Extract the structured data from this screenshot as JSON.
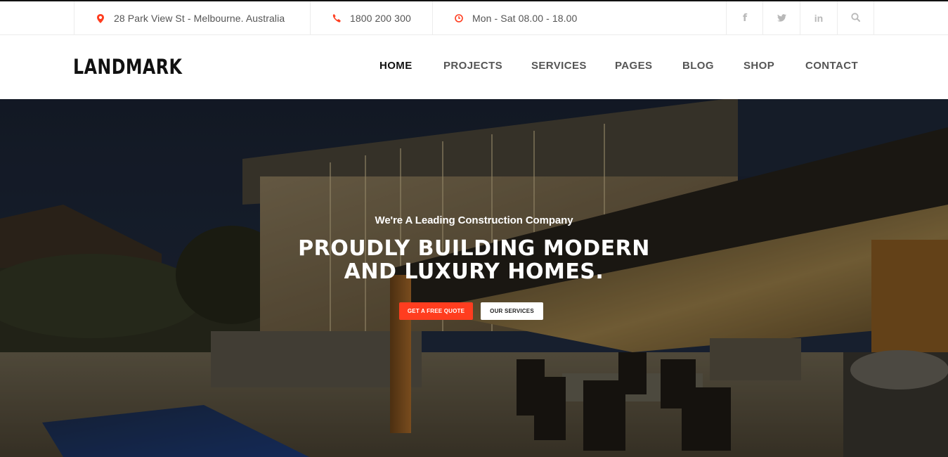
{
  "topbar": {
    "address": "28 Park View St - Melbourne. Australia",
    "phone": "1800 200 300",
    "hours": "Mon - Sat 08.00 - 18.00",
    "icons": {
      "address": "map-marker-icon",
      "phone": "phone-icon",
      "hours": "clock-icon"
    },
    "social": [
      {
        "name": "facebook",
        "glyph": "f"
      },
      {
        "name": "twitter",
        "glyph": "twitter-bird"
      },
      {
        "name": "linkedin",
        "glyph": "in"
      },
      {
        "name": "search",
        "glyph": "magnifier"
      }
    ]
  },
  "header": {
    "logo": "LANDMARK",
    "nav": [
      {
        "label": "HOME",
        "active": true
      },
      {
        "label": "PROJECTS"
      },
      {
        "label": "SERVICES"
      },
      {
        "label": "PAGES"
      },
      {
        "label": "BLOG"
      },
      {
        "label": "SHOP"
      },
      {
        "label": "CONTACT"
      }
    ]
  },
  "hero": {
    "subtitle": "We're A Leading Construction Company",
    "title_line1": "PROUDLY BUILDING MODERN",
    "title_line2": "AND LUXURY HOMES.",
    "buttons": {
      "primary": "GET A FREE QUOTE",
      "secondary": "OUR SERVICES"
    }
  },
  "colors": {
    "accent": "#ff3d1f",
    "text_dark": "#111111",
    "text_nav": "#555555",
    "icon_muted": "#b8b8b8",
    "border": "#ececec"
  }
}
